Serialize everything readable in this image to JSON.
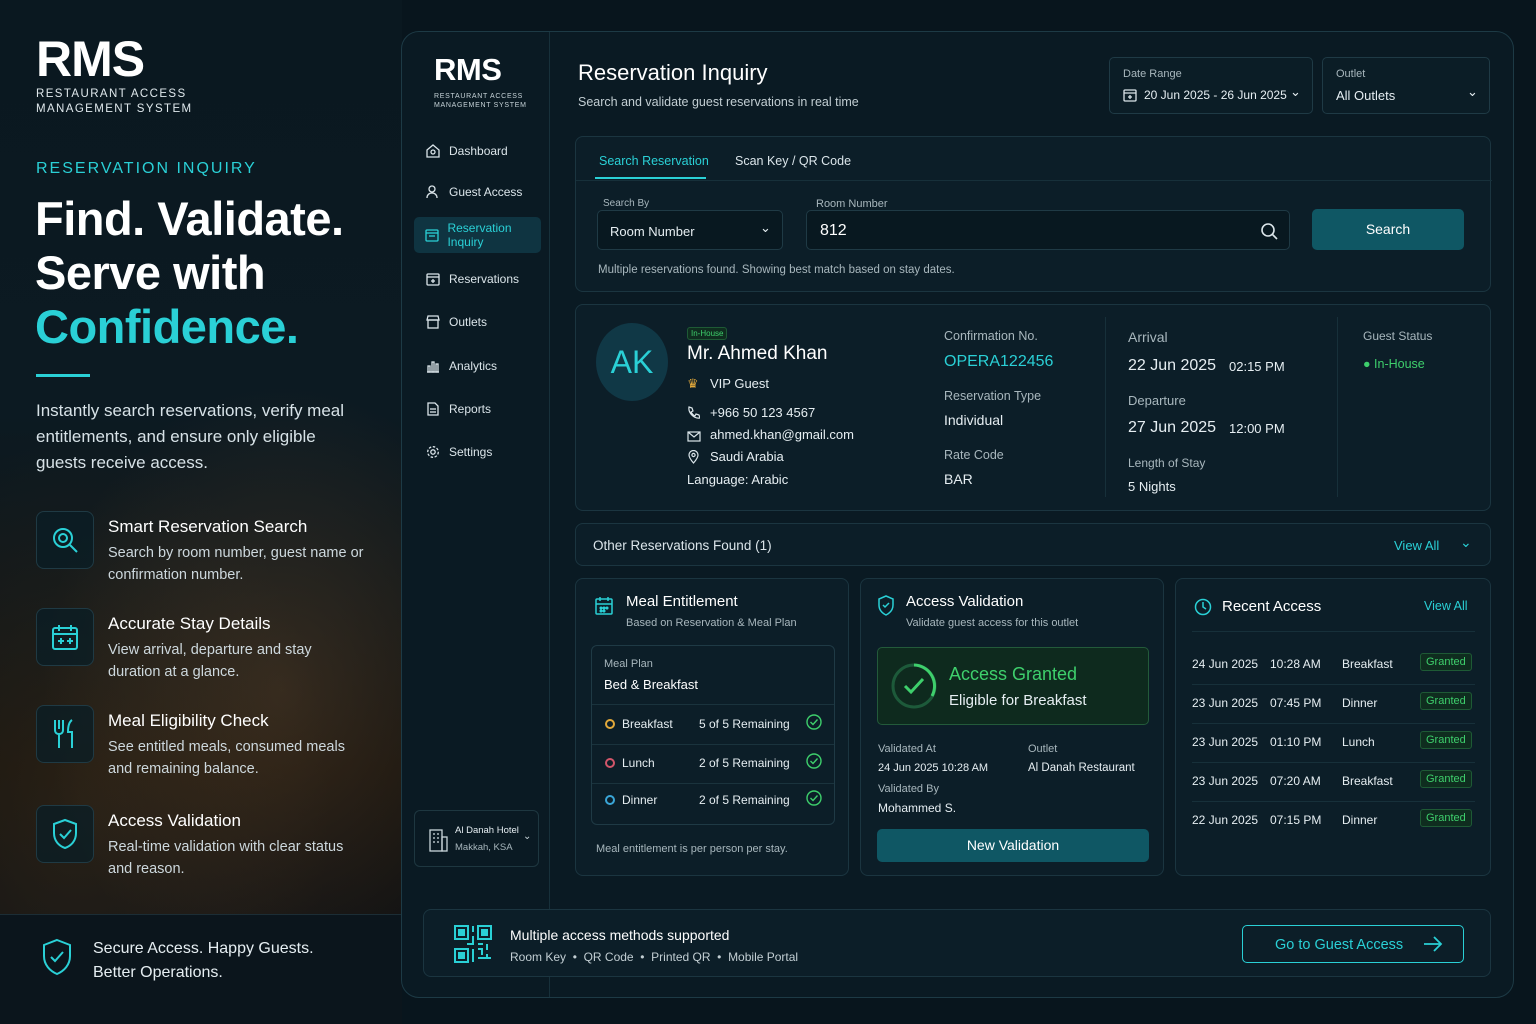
{
  "hero": {
    "logo": "RMS",
    "logo_sub_1": "RESTAURANT ACCESS",
    "logo_sub_2": "MANAGEMENT SYSTEM",
    "eyebrow": "RESERVATION INQUIRY",
    "headline_1": "Find. Validate.",
    "headline_2": "Serve with",
    "headline_3": "Confidence.",
    "intro": "Instantly search reservations, verify meal entitlements, and ensure only eligible guests receive access.",
    "features": [
      {
        "title": "Smart Reservation Search",
        "desc": "Search by room number, guest name or confirmation number.",
        "icon": "search-icon"
      },
      {
        "title": "Accurate Stay Details",
        "desc": "View arrival, departure and stay duration at a glance.",
        "icon": "calendar-icon"
      },
      {
        "title": "Meal Eligibility Check",
        "desc": "See entitled meals, consumed meals and remaining balance.",
        "icon": "cutlery-icon"
      },
      {
        "title": "Access Validation",
        "desc": "Real-time validation with clear status and reason.",
        "icon": "shield-check-icon"
      }
    ],
    "footer": "Secure Access. Happy Guests. Better Operations."
  },
  "sidebar": {
    "logo": "RMS",
    "logo_sub_1": "RESTAURANT ACCESS",
    "logo_sub_2": "MANAGEMENT SYSTEM",
    "items": [
      "Dashboard",
      "Guest Access",
      "Reservation Inquiry",
      "Reservations",
      "Outlets",
      "Analytics",
      "Reports",
      "Settings"
    ],
    "hotel_name": "Al Danah Hotel",
    "hotel_location": "Makkah, KSA"
  },
  "header": {
    "title": "Reservation Inquiry",
    "subtitle": "Search and validate guest reservations in real time",
    "date_label": "Date Range",
    "date_value": "20 Jun 2025 - 26 Jun 2025",
    "outlet_label": "Outlet",
    "outlet_value": "All Outlets"
  },
  "search": {
    "tab_1": "Search Reservation",
    "tab_2": "Scan Key / QR Code",
    "search_by_label": "Search By",
    "search_by_value": "Room Number",
    "room_label": "Room Number",
    "room_value": "812",
    "button": "Search",
    "note": "Multiple reservations found. Showing best match based on stay dates."
  },
  "guest": {
    "initials": "AK",
    "status_tag": "In-House",
    "name": "Mr. Ahmed Khan",
    "tier": "VIP Guest",
    "phone": "+966 50 123 4567",
    "email": "ahmed.khan@gmail.com",
    "country": "Saudi Arabia",
    "language": "Language: Arabic",
    "conf_label": "Confirmation No.",
    "conf_value": "OPERA122456",
    "type_label": "Reservation Type",
    "type_value": "Individual",
    "rate_label": "Rate Code",
    "rate_value": "BAR",
    "arrival_label": "Arrival",
    "arrival_date": "22 Jun 2025",
    "arrival_time": "02:15 PM",
    "departure_label": "Departure",
    "departure_date": "27 Jun 2025",
    "departure_time": "12:00 PM",
    "los_label": "Length of Stay",
    "los_value": "5 Nights",
    "status_label": "Guest Status",
    "status_value": "In-House"
  },
  "other": {
    "label": "Other Reservations Found (1)",
    "view_all": "View All"
  },
  "meal": {
    "title": "Meal Entitlement",
    "subtitle": "Based on Reservation & Meal Plan",
    "plan_label": "Meal Plan",
    "plan_value": "Bed & Breakfast",
    "items": [
      {
        "name": "Breakfast",
        "remaining": "5 of 5 Remaining",
        "color": "#e3a93b"
      },
      {
        "name": "Lunch",
        "remaining": "2 of 5 Remaining",
        "color": "#d2566a"
      },
      {
        "name": "Dinner",
        "remaining": "2 of 5 Remaining",
        "color": "#3aa6d8"
      }
    ],
    "note": "Meal entitlement is per person per stay."
  },
  "access": {
    "title": "Access Validation",
    "subtitle": "Validate guest access for this outlet",
    "result_title": "Access Granted",
    "result_sub": "Eligible for Breakfast",
    "validated_at_label": "Validated At",
    "validated_at": "24 Jun 2025 10:28 AM",
    "outlet_label": "Outlet",
    "outlet_value": "Al Danah Restaurant",
    "validated_by_label": "Validated By",
    "validated_by": "Mohammed S.",
    "button": "New Validation"
  },
  "recent": {
    "title": "Recent Access",
    "view_all": "View All",
    "rows": [
      {
        "date": "24 Jun 2025",
        "time": "10:28 AM",
        "meal": "Breakfast",
        "status": "Granted"
      },
      {
        "date": "23 Jun 2025",
        "time": "07:45 PM",
        "meal": "Dinner",
        "status": "Granted"
      },
      {
        "date": "23 Jun 2025",
        "time": "01:10 PM",
        "meal": "Lunch",
        "status": "Granted"
      },
      {
        "date": "23 Jun 2025",
        "time": "07:20 AM",
        "meal": "Breakfast",
        "status": "Granted"
      },
      {
        "date": "22 Jun 2025",
        "time": "07:15 PM",
        "meal": "Dinner",
        "status": "Granted"
      }
    ]
  },
  "methods": {
    "title": "Multiple access methods supported",
    "items": [
      "Room Key",
      "QR Code",
      "Printed QR",
      "Mobile Portal"
    ],
    "button": "Go to Guest Access"
  },
  "colors": {
    "accent": "#2ad0d6",
    "granted": "#3ecf6c",
    "background": "#08151d"
  }
}
